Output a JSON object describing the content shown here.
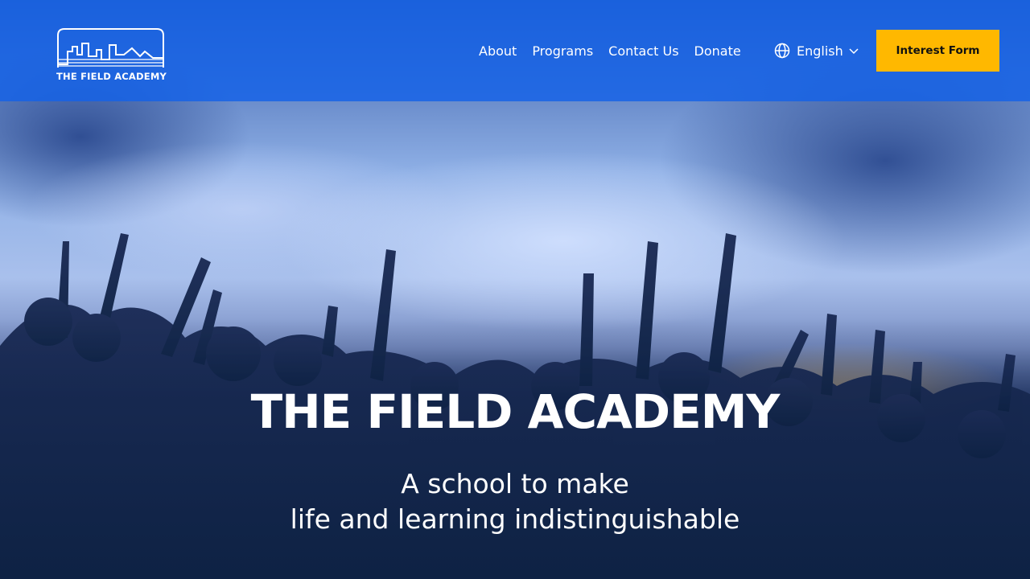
{
  "brand": {
    "name": "THE FIELD ACADEMY"
  },
  "nav": {
    "items": [
      {
        "label": "About"
      },
      {
        "label": "Programs"
      },
      {
        "label": "Contact Us"
      },
      {
        "label": "Donate"
      }
    ],
    "language": {
      "label": "English",
      "icon": "globe-icon"
    }
  },
  "cta": {
    "label": "Interest Form",
    "color": "#ffb800"
  },
  "hero": {
    "title": "THE FIELD ACADEMY",
    "subtitle_line1": "A school to make",
    "subtitle_line2": "life and learning indistinguishable"
  },
  "colors": {
    "header": "#1362e8",
    "text": "#ffffff"
  }
}
